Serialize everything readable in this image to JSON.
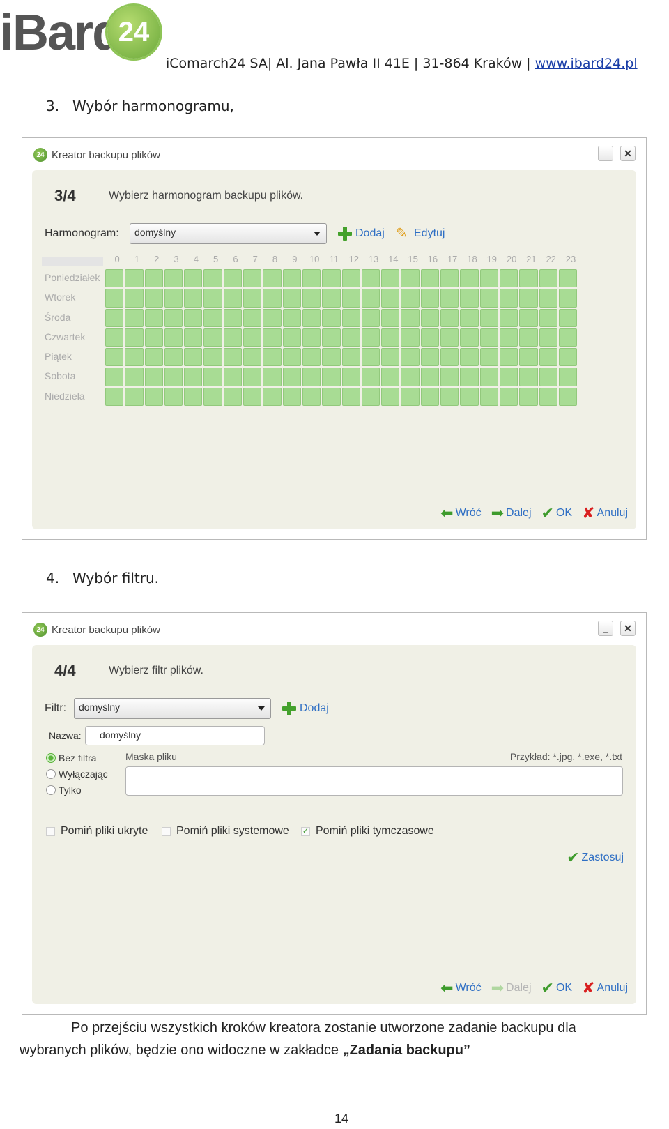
{
  "header": {
    "logo_text": "iBard",
    "logo_badge": "24",
    "company": "iComarch24 SA| Al. Jana Pawła II 41E | 31-864 Kraków |",
    "website": "www.ibard24.pl"
  },
  "section3": {
    "number": "3.",
    "title": "Wybór harmonogramu,"
  },
  "section4": {
    "number": "4.",
    "title": "Wybór filtru."
  },
  "schedule_window": {
    "title": "Kreator backupu plików",
    "icon_badge": "24",
    "minimize": "_",
    "close": "✕",
    "step": "3/4",
    "step_desc": "Wybierz harmonogram backupu plików.",
    "schedule_label": "Harmonogram:",
    "schedule_value": "domyślny",
    "add_label": "Dodaj",
    "edit_label": "Edytuj",
    "hours": [
      "0",
      "1",
      "2",
      "3",
      "4",
      "5",
      "6",
      "7",
      "8",
      "9",
      "10",
      "11",
      "12",
      "13",
      "14",
      "15",
      "16",
      "17",
      "18",
      "19",
      "20",
      "21",
      "22",
      "23"
    ],
    "days": [
      "Poniedziałek",
      "Wtorek",
      "Środa",
      "Czwartek",
      "Piątek",
      "Sobota",
      "Niedziela"
    ],
    "back": "Wróć",
    "next": "Dalej",
    "ok": "OK",
    "cancel": "Anuluj"
  },
  "filter_window": {
    "title": "Kreator backupu plików",
    "icon_badge": "24",
    "minimize": "_",
    "close": "✕",
    "step": "4/4",
    "step_desc": "Wybierz filtr plików.",
    "filter_label": "Filtr:",
    "filter_value": "domyślny",
    "add_label": "Dodaj",
    "name_label": "Nazwa:",
    "name_value": "domyślny",
    "radio_options": [
      "Bez filtra",
      "Wyłączając",
      "Tylko"
    ],
    "selected_radio": "Bez filtra",
    "mask_label": "Maska pliku",
    "example": "Przykład: *.jpg, *.exe, *.txt",
    "skip_hidden": "Pomiń pliki ukryte",
    "skip_system": "Pomiń pliki systemowe",
    "skip_temp": "Pomiń pliki tymczasowe",
    "apply": "Zastosuj",
    "back": "Wróć",
    "next": "Dalej",
    "ok": "OK",
    "cancel": "Anuluj"
  },
  "paragraph": {
    "line1": "Po przejściu wszystkich kroków kreatora zostanie utworzone zadanie backupu dla",
    "line2": "wybranych plików, będzie ono widoczne w zakładce ",
    "bold": "„Zadania backupu”"
  },
  "page_number": "14"
}
